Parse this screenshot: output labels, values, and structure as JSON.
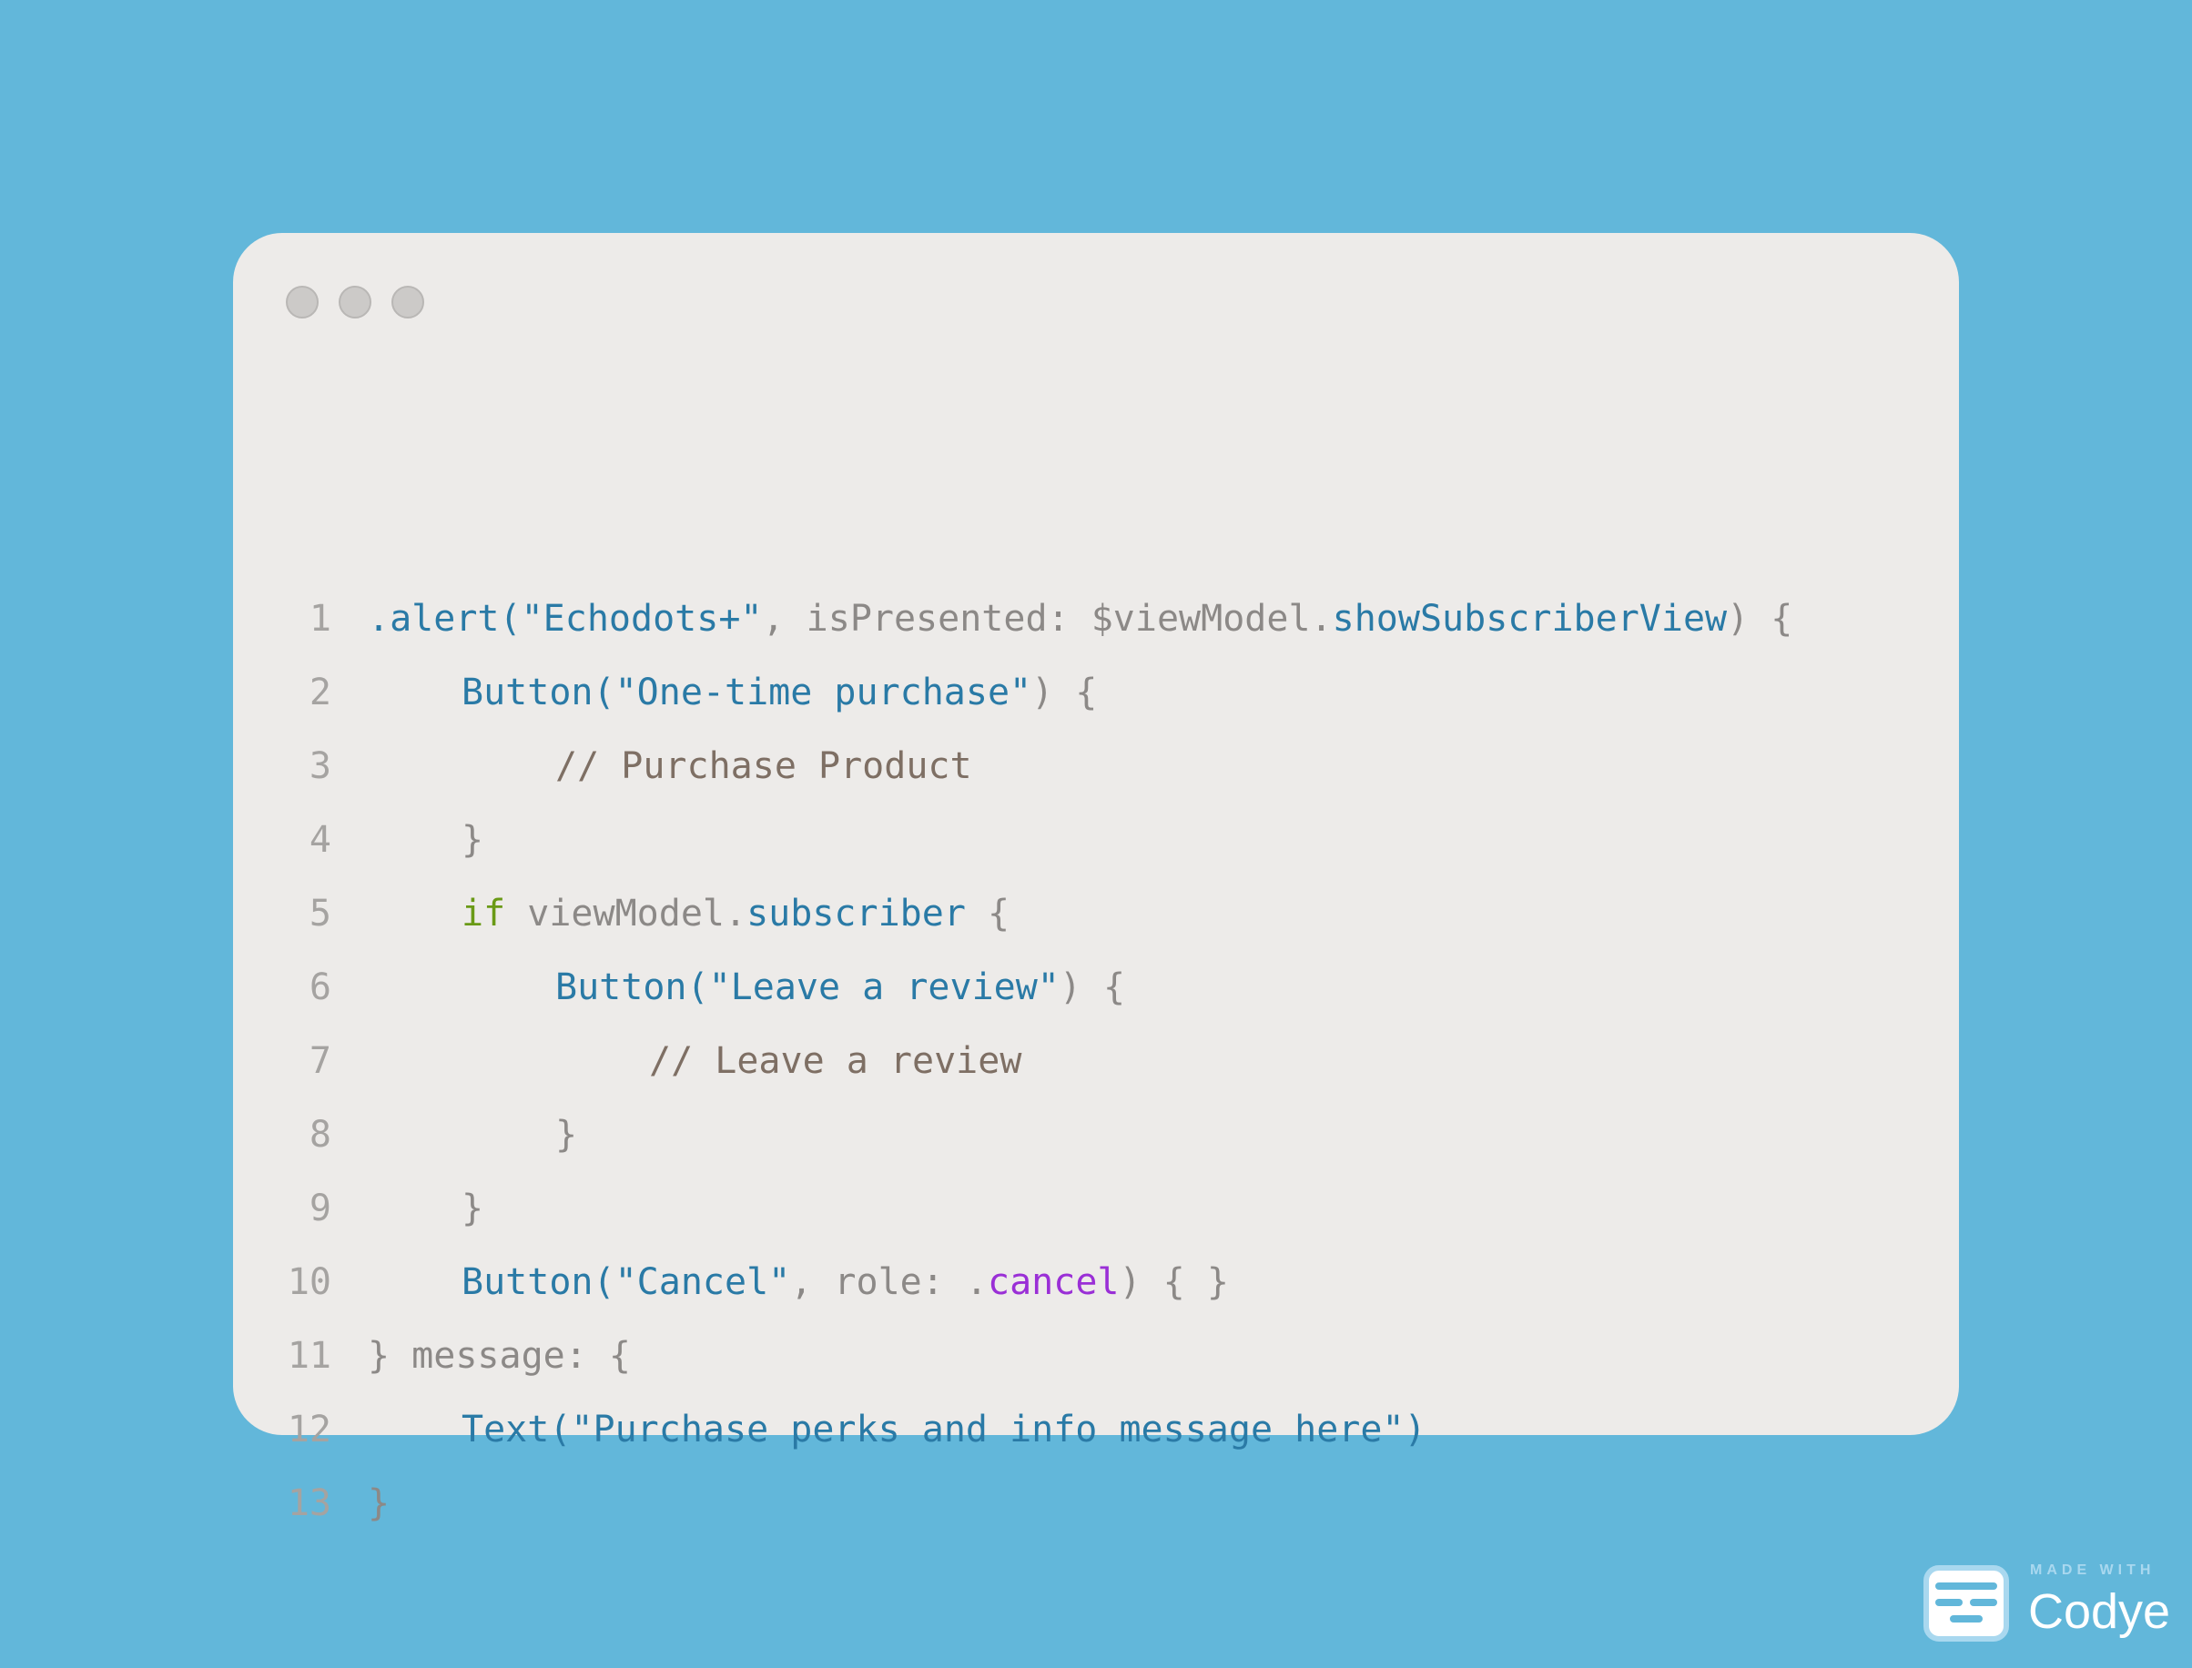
{
  "colors": {
    "background": "#62b7da",
    "window": "#edebe9",
    "line_number": "#a5a3a1",
    "default": "#8c8987",
    "call": "#2a7aa6",
    "string": "#2a7aa6",
    "comment": "#7e6f64",
    "keyword": "#6a9a16",
    "enum_case": "#9a2fd6"
  },
  "window_controls": [
    "close-dot",
    "minimize-dot",
    "maximize-dot"
  ],
  "code_lines": [
    {
      "number": "1",
      "indent": 0,
      "tokens": [
        {
          "t": ".alert(",
          "c": "call"
        },
        {
          "t": "\"Echodots+\"",
          "c": "str"
        },
        {
          "t": ", isPresented: $viewModel.",
          "c": "default"
        },
        {
          "t": "showSubscriberView",
          "c": "call"
        },
        {
          "t": ") {",
          "c": "default"
        }
      ]
    },
    {
      "number": "2",
      "indent": 1,
      "tokens": [
        {
          "t": "Button(",
          "c": "call"
        },
        {
          "t": "\"One-time purchase\"",
          "c": "str"
        },
        {
          "t": ") {",
          "c": "default"
        }
      ]
    },
    {
      "number": "3",
      "indent": 2,
      "tokens": [
        {
          "t": "// Purchase Product",
          "c": "comment"
        }
      ]
    },
    {
      "number": "4",
      "indent": 1,
      "tokens": [
        {
          "t": "}",
          "c": "default"
        }
      ]
    },
    {
      "number": "5",
      "indent": 1,
      "tokens": [
        {
          "t": "if",
          "c": "kw"
        },
        {
          "t": " viewModel.",
          "c": "default"
        },
        {
          "t": "subscriber",
          "c": "call"
        },
        {
          "t": " {",
          "c": "default"
        }
      ]
    },
    {
      "number": "6",
      "indent": 2,
      "tokens": [
        {
          "t": "Button(",
          "c": "call"
        },
        {
          "t": "\"Leave a review\"",
          "c": "str"
        },
        {
          "t": ") {",
          "c": "default"
        }
      ]
    },
    {
      "number": "7",
      "indent": 3,
      "tokens": [
        {
          "t": "// Leave a review",
          "c": "comment"
        }
      ]
    },
    {
      "number": "8",
      "indent": 2,
      "tokens": [
        {
          "t": "}",
          "c": "default"
        }
      ]
    },
    {
      "number": "9",
      "indent": 1,
      "tokens": [
        {
          "t": "}",
          "c": "default"
        }
      ]
    },
    {
      "number": "10",
      "indent": 1,
      "tokens": [
        {
          "t": "Button(",
          "c": "call"
        },
        {
          "t": "\"Cancel\"",
          "c": "str"
        },
        {
          "t": ", role: .",
          "c": "default"
        },
        {
          "t": "cancel",
          "c": "enum"
        },
        {
          "t": ") { }",
          "c": "default"
        }
      ]
    },
    {
      "number": "11",
      "indent": 0,
      "tokens": [
        {
          "t": "} message: {",
          "c": "default"
        }
      ]
    },
    {
      "number": "12",
      "indent": 1,
      "tokens": [
        {
          "t": "Text(",
          "c": "call"
        },
        {
          "t": "\"Purchase perks and info message here\"",
          "c": "str"
        },
        {
          "t": ")",
          "c": "call"
        }
      ]
    },
    {
      "number": "13",
      "indent": 0,
      "tokens": [
        {
          "t": "}",
          "c": "default"
        }
      ]
    }
  ],
  "badge": {
    "small": "MADE WITH",
    "big": "Codye",
    "icon": "codye-logo-icon"
  }
}
